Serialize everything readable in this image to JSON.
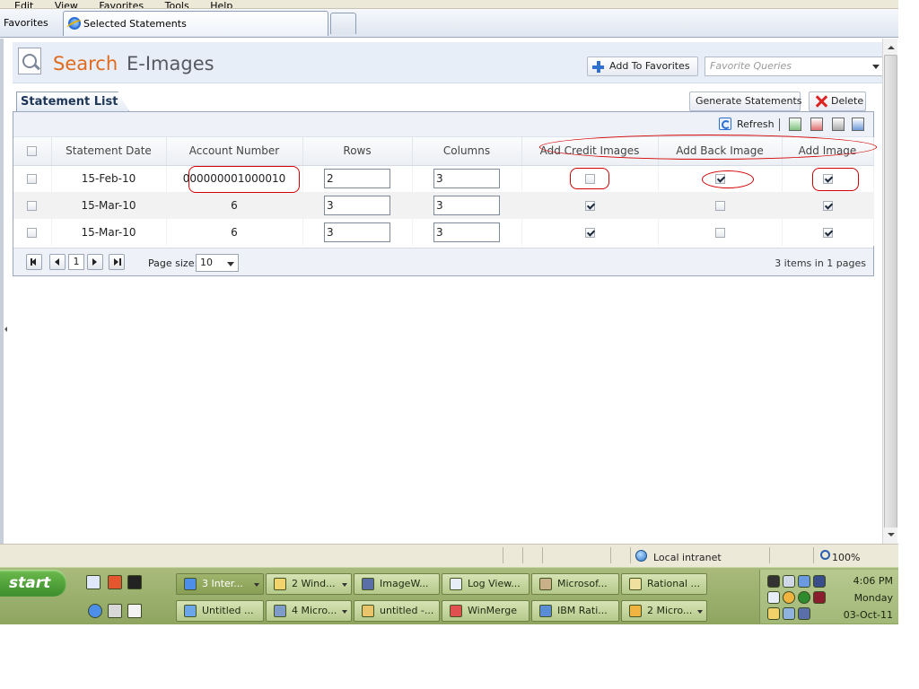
{
  "browser": {
    "menu": [
      "Edit",
      "View",
      "Favorites",
      "Tools",
      "Help"
    ],
    "favorites_label": "Favorites",
    "tab_title": "Selected Statements"
  },
  "page": {
    "title_part1": "Search",
    "title_part2": "E-Images",
    "add_favorites_label": "Add To Favorites",
    "favorite_queries_placeholder": "Favorite Queries",
    "list_tab_label": "Statement List",
    "generate_label": "Generate Statements",
    "delete_label": "Delete",
    "refresh_label": "Refresh",
    "accent_color": "#e06a1e"
  },
  "grid": {
    "columns": [
      "Statement Date",
      "Account Number",
      "Rows",
      "Columns",
      "Add Credit Images",
      "Add Back Image",
      "Add Image"
    ],
    "rows": [
      {
        "selected": false,
        "date": "15-Feb-10",
        "account": "000000001000010",
        "rows": "2",
        "cols": "3",
        "credit": false,
        "back": true,
        "image": true
      },
      {
        "selected": false,
        "date": "15-Mar-10",
        "account": "6",
        "rows": "3",
        "cols": "3",
        "credit": true,
        "back": false,
        "image": true
      },
      {
        "selected": false,
        "date": "15-Mar-10",
        "account": "6",
        "rows": "3",
        "cols": "3",
        "credit": true,
        "back": false,
        "image": true
      }
    ]
  },
  "pager": {
    "current_page": "1",
    "page_size_label": "Page size:",
    "page_size": "10",
    "info": "3 items in 1 pages"
  },
  "status": {
    "zone": "Local intranet",
    "zoom": "100%"
  },
  "taskbar": {
    "start_label": "start",
    "tasks_row1": [
      "3 Inter...",
      "2 Wind...",
      "ImageW...",
      "Log View...",
      "Microsof...",
      "Rational ..."
    ],
    "tasks_row2": [
      "Untitled ...",
      "4 Micro...",
      "untitled -...",
      "WinMerge",
      "IBM Rati...",
      "2 Micro..."
    ],
    "clock_time": "4:06 PM",
    "clock_day": "Monday",
    "clock_date": "03-Oct-11"
  }
}
